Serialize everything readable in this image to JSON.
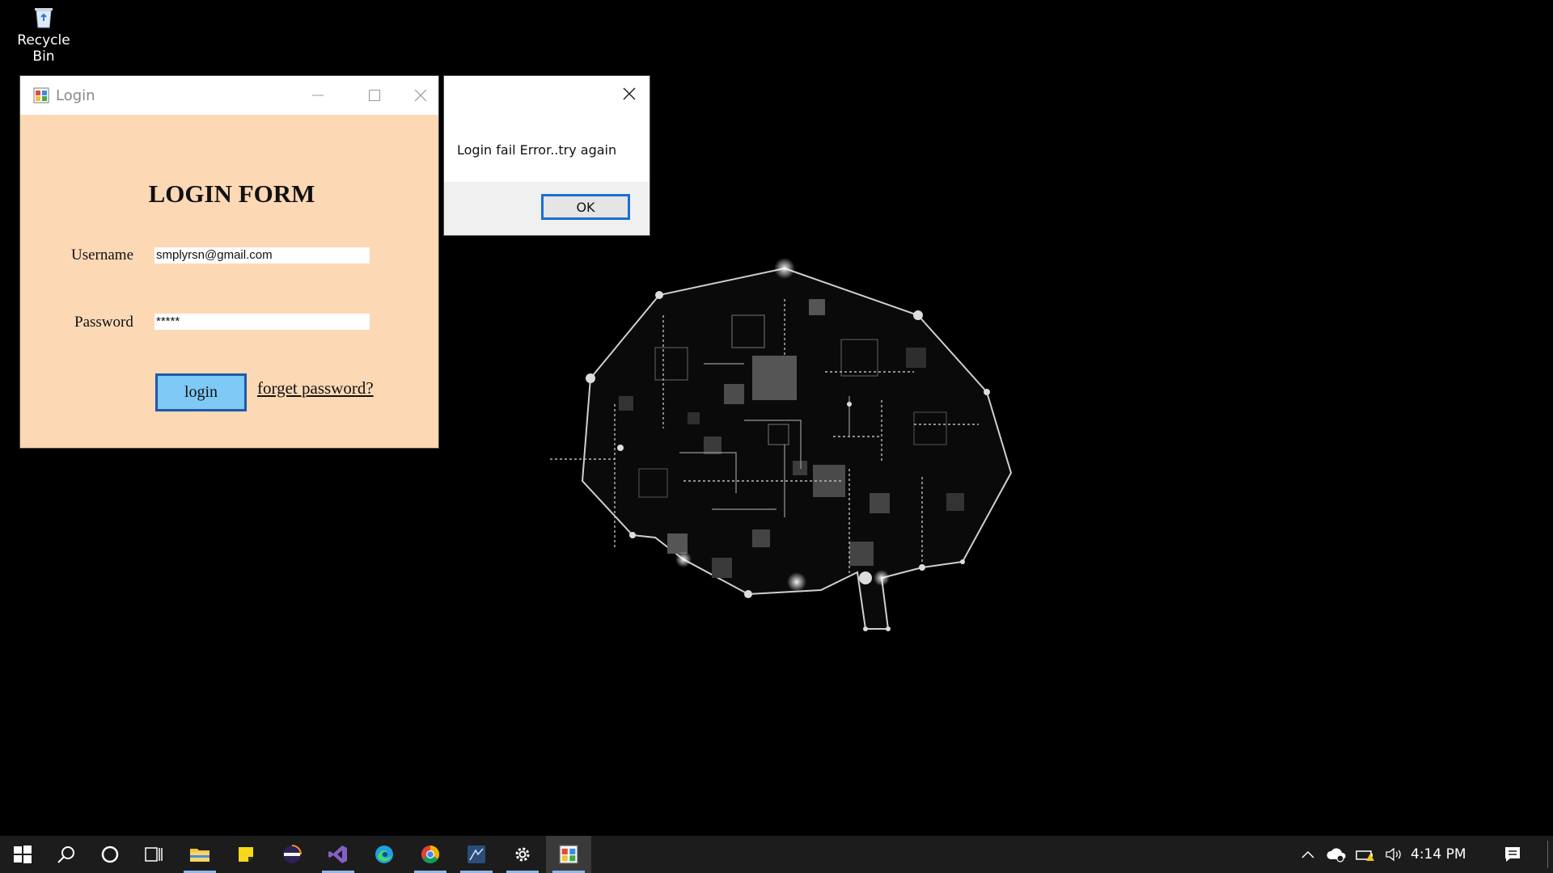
{
  "desktop": {
    "recycle_bin_label": "Recycle Bin"
  },
  "login_window": {
    "title": "Login",
    "form_title": "LOGIN FORM",
    "username_label": "Username",
    "username_value": "smplyrsn@gmail.com",
    "password_label": "Password",
    "password_value": "*****",
    "login_button": "login",
    "forget_link": "forget password?",
    "colors": {
      "form_background": "#fdd8b5",
      "button_background": "#7ec9f5",
      "button_border": "#1e5aa8"
    }
  },
  "message_box": {
    "message": "Login fail Error..try again",
    "ok_label": "OK"
  },
  "taskbar": {
    "items": [
      {
        "icon": "windows-start-icon"
      },
      {
        "icon": "search-icon"
      },
      {
        "icon": "cortana-icon"
      },
      {
        "icon": "task-view-icon"
      },
      {
        "icon": "file-explorer-icon",
        "running": true
      },
      {
        "icon": "sticky-notes-icon"
      },
      {
        "icon": "eclipse-icon"
      },
      {
        "icon": "visual-studio-icon",
        "running": true
      },
      {
        "icon": "edge-icon"
      },
      {
        "icon": "chrome-icon",
        "running": true
      },
      {
        "icon": "app-icon",
        "running": true
      },
      {
        "icon": "settings-icon",
        "running": true
      },
      {
        "icon": "login-app-icon",
        "running": true,
        "current": true
      }
    ],
    "tray_icons": [
      "chevron-up-icon",
      "onedrive-icon",
      "battery-warning-icon",
      "volume-icon"
    ],
    "clock": "4:14 PM",
    "notification_icon": "action-center-icon"
  }
}
